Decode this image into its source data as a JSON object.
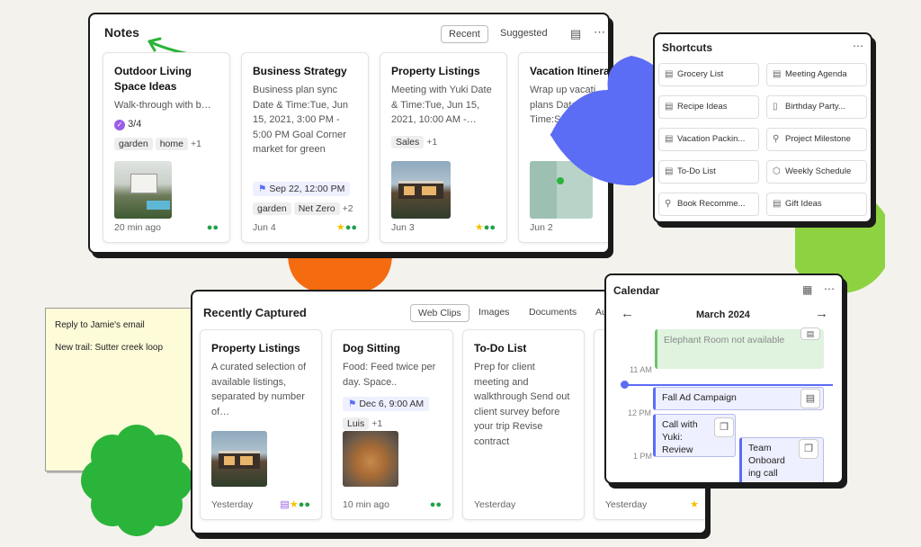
{
  "colors": {
    "accent_blue": "#5b6cf5",
    "green": "#2bb43a",
    "orange": "#f46b10",
    "lime": "#8dd341",
    "sticky": "#fdfbd8"
  },
  "notes": {
    "title": "Notes",
    "tabs": [
      "Recent",
      "Suggested"
    ],
    "cards": [
      {
        "title": "Outdoor Living Space Ideas",
        "body": "Walk-through with b…",
        "progress": "3/4",
        "tags": [
          "garden",
          "home"
        ],
        "more": "+1",
        "footer": "20 min ago"
      },
      {
        "title": "Business Strategy",
        "body": "Business plan sync Date & Time:Tue, Jun 15, 2021, 3:00 PM - 5:00 PM Goal Corner market for green",
        "reminder": "Sep 22, 12:00 PM",
        "tags": [
          "garden",
          "Net Zero"
        ],
        "more": "+2",
        "footer": "Jun 4"
      },
      {
        "title": "Property Listings",
        "body": "Meeting with Yuki Date & Time:Tue, Jun 15, 2021, 10:00 AM -…",
        "tags": [
          "Sales"
        ],
        "more": "+1",
        "footer": "Jun 3"
      },
      {
        "title": "Vacation Itinera",
        "body": "Wrap up vacati plans Date & Time:Sa 2021,",
        "footer": "Jun 2"
      }
    ]
  },
  "shortcuts": {
    "title": "Shortcuts",
    "items": [
      {
        "label": "Grocery List",
        "icon": "note-icon"
      },
      {
        "label": "Meeting Agenda",
        "icon": "note-icon"
      },
      {
        "label": "Recipe Ideas",
        "icon": "note-icon"
      },
      {
        "label": "Birthday Party...",
        "icon": "notebook-icon"
      },
      {
        "label": "Vacation Packin...",
        "icon": "note-icon"
      },
      {
        "label": "Project Milestone",
        "icon": "search-icon"
      },
      {
        "label": "To-Do List",
        "icon": "note-icon"
      },
      {
        "label": "Weekly Schedule",
        "icon": "cube-icon"
      },
      {
        "label": "Book Recomme...",
        "icon": "search-icon"
      },
      {
        "label": "Gift Ideas",
        "icon": "note-icon"
      }
    ]
  },
  "sticky": {
    "lines": [
      "Reply to Jamie's email",
      "New trail: Sutter creek loop"
    ]
  },
  "recent": {
    "title": "Recently Captured",
    "tabs": [
      "Web Clips",
      "Images",
      "Documents",
      "Au"
    ],
    "cards": [
      {
        "title": "Property Listings",
        "body": "A curated selection of available listings, separated by number of…",
        "footer": "Yesterday"
      },
      {
        "title": "Dog Sitting",
        "body": "Food: Feed twice per day. Space..",
        "reminder": "Dec 6, 9:00 AM",
        "tags": [
          "Luis"
        ],
        "more": "+1",
        "footer": "10 min ago"
      },
      {
        "title": "To-Do List",
        "body": "Prep for client meeting and walkthrough Send out client survey before your trip Revise contract",
        "footer": "Yesterday"
      },
      {
        "footer": "Yesterday"
      }
    ]
  },
  "calendar": {
    "title": "Calendar",
    "month": "March 2024",
    "times": [
      "11 AM",
      "12 PM",
      "1 PM"
    ],
    "events": [
      "Elephant Room not available",
      "Fall Ad Campaign",
      "Call with Yuki: Review",
      "Team Onboard ing call"
    ]
  }
}
